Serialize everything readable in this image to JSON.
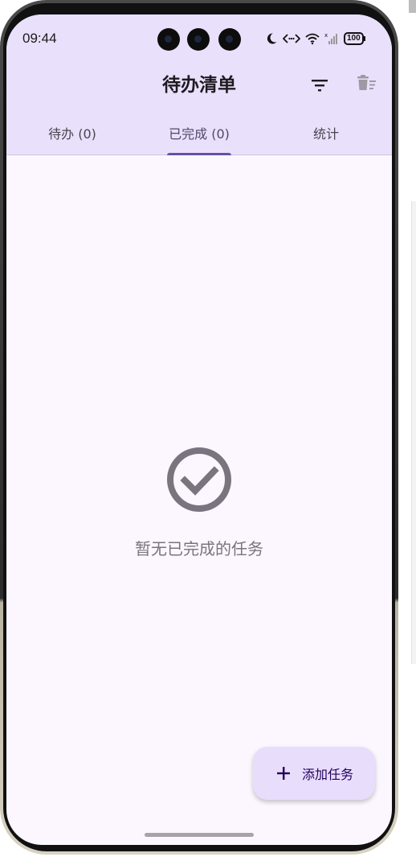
{
  "status_bar": {
    "time": "09:44",
    "battery": "100",
    "icons": [
      "moon-icon",
      "data-arrows-icon",
      "wifi-icon",
      "signal-icon",
      "battery-icon"
    ]
  },
  "app_bar": {
    "title": "待办清单",
    "actions": [
      "filter-icon",
      "delete-sweep-icon"
    ]
  },
  "tabs": [
    {
      "label": "待办 (0)",
      "selected": false
    },
    {
      "label": "已完成 (0)",
      "selected": true
    },
    {
      "label": "统计",
      "selected": false
    }
  ],
  "empty_state": {
    "icon": "check-circle-icon",
    "message": "暂无已完成的任务"
  },
  "fab": {
    "icon": "plus-icon",
    "label": "添加任务"
  },
  "colors": {
    "app_bar_bg": "#e9e0fc",
    "screen_bg": "#fcf7fe",
    "accent": "#6750a4",
    "fab_bg": "#e9ddfc",
    "muted_text": "#79747e"
  }
}
